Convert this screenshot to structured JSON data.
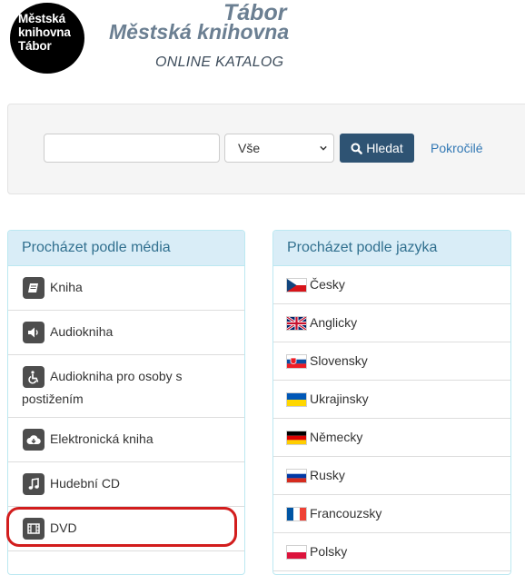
{
  "header": {
    "logo_lines": [
      "Městská",
      "knihovna",
      "Tábor"
    ],
    "city": "Tábor",
    "library": "Městská knihovna",
    "catalog": "ONLINE KATALOG",
    "colors": {
      "title": "#6b7f92",
      "logo_bg": "#000000"
    }
  },
  "search": {
    "input_value": "",
    "select_value": "Vše",
    "button_label": "Hledat",
    "button_icon": "search-icon",
    "advanced_label": "Pokročilé",
    "colors": {
      "button": "#2e5373",
      "link": "#3278b4"
    }
  },
  "media_panel": {
    "title": "Procházet podle média",
    "items": [
      {
        "label": "Kniha",
        "icon": "book-icon"
      },
      {
        "label": "Audiokniha",
        "icon": "volume-icon"
      },
      {
        "label": "Audiokniha pro osoby s",
        "label_line2": "postižením",
        "icon": "wheelchair-icon"
      },
      {
        "label": "Elektronická kniha",
        "icon": "cloud-download-icon"
      },
      {
        "label": "Hudební CD",
        "icon": "music-note-icon"
      },
      {
        "label": "DVD",
        "icon": "film-icon"
      }
    ]
  },
  "language_panel": {
    "title": "Procházet podle jazyka",
    "items": [
      {
        "label": "Česky",
        "flag": "czech-flag-icon"
      },
      {
        "label": "Anglicky",
        "flag": "uk-flag-icon"
      },
      {
        "label": "Slovensky",
        "flag": "slovak-flag-icon"
      },
      {
        "label": "Ukrajinsky",
        "flag": "ukraine-flag-icon"
      },
      {
        "label": "Německy",
        "flag": "germany-flag-icon"
      },
      {
        "label": "Rusky",
        "flag": "russia-flag-icon"
      },
      {
        "label": "Francouzsky",
        "flag": "france-flag-icon"
      },
      {
        "label": "Polsky",
        "flag": "poland-flag-icon"
      }
    ]
  },
  "annotation": {
    "color": "#d21d1d",
    "highlighted_item": "DVD"
  }
}
